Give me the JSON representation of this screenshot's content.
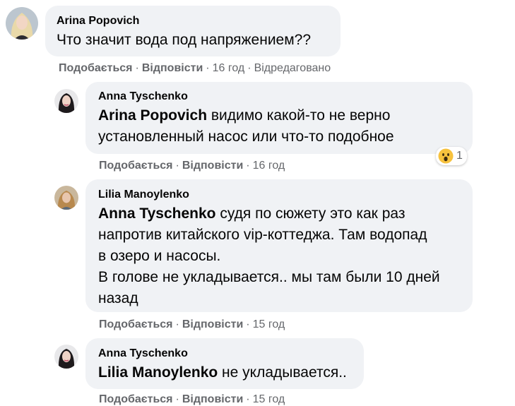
{
  "comments": [
    {
      "author": "Arina Popovich",
      "mention": "",
      "text": "Что значит вода под напряжением??",
      "like": "Подобається",
      "reply": "Відповісти",
      "time": "16 год",
      "edited": "Відредаговано"
    },
    {
      "author": "Anna Tyschenko",
      "mention": "Arina Popovich",
      "text": "видимо какой-то не верно\nустановленный насос или что-то подобное",
      "like": "Подобається",
      "reply": "Відповісти",
      "time": "16 год",
      "reaction": {
        "icon": "wow-emoji-icon",
        "count": "1"
      }
    },
    {
      "author": "Lilia Manoylenko",
      "mention": "Anna Tyschenko",
      "text": "судя по сюжету это как раз\nнапротив китайского vip-коттеджа. Там водопад\nв озеро и насосы.\nВ голове не укладывается.. мы там были 10 дней\nназад",
      "like": "Подобається",
      "reply": "Відповісти",
      "time": "15 год"
    },
    {
      "author": "Anna Tyschenko",
      "mention": "Lilia Manoylenko",
      "text": "не укладывается..",
      "like": "Подобається",
      "reply": "Відповісти",
      "time": "15 год"
    }
  ],
  "separator": "·",
  "colors": {
    "bubble": "#f0f2f5",
    "meta": "#65676b",
    "text": "#050505"
  }
}
